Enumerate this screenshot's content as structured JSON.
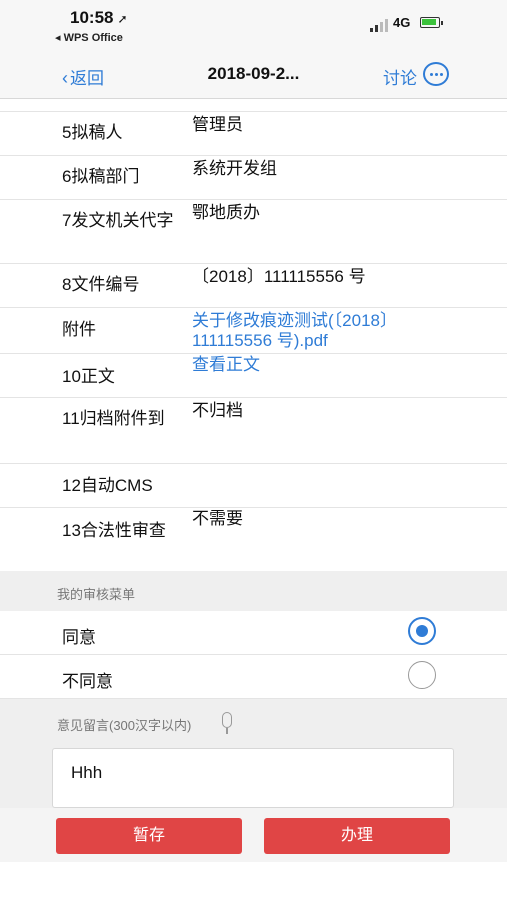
{
  "status": {
    "time": "10:58",
    "back_app": "◂ WPS Office",
    "network": "4G"
  },
  "nav": {
    "back_label": "返回",
    "title": "2018-09-2...",
    "discuss_label": "讨论"
  },
  "fields": [
    {
      "label": "5拟稿人",
      "value": "管理员"
    },
    {
      "label": "6拟稿部门",
      "value": "系统开发组"
    },
    {
      "label": "7发文机关代字",
      "value": "鄂地质办"
    },
    {
      "label": "8文件编号",
      "value": "〔2018〕111115556 号"
    },
    {
      "label": "附件",
      "value": "关于修改痕迹测试(〔2018〕111115556 号).pdf"
    },
    {
      "label": "10正文",
      "value": "查看正文"
    },
    {
      "label": "11归档附件到",
      "value": "不归档"
    },
    {
      "label": "12自动CMS",
      "value": ""
    },
    {
      "label": "13合法性审查",
      "value": "不需要"
    }
  ],
  "review": {
    "section_title": "我的审核菜单",
    "options": [
      {
        "label": "同意",
        "selected": true
      },
      {
        "label": "不同意",
        "selected": false
      }
    ]
  },
  "comment": {
    "section_title": "意见留言(300汉字以内)",
    "value": "Hhh"
  },
  "actions": {
    "save_label": "暂存",
    "process_label": "办理"
  },
  "colors": {
    "accent": "#2f7cd6",
    "button": "#e04545"
  }
}
